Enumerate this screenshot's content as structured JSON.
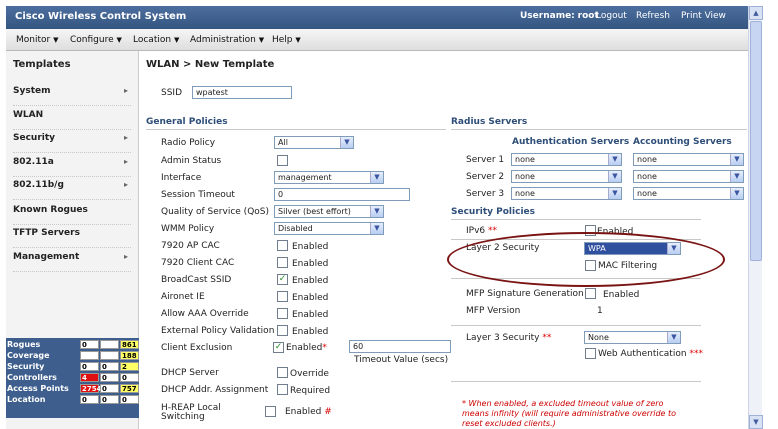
{
  "header": {
    "title": "Cisco Wireless Control System",
    "username_label": "Username:",
    "username": "root",
    "links": [
      "Logout",
      "Refresh",
      "Print View"
    ]
  },
  "menu": [
    "Monitor",
    "Configure",
    "Location",
    "Administration",
    "Help"
  ],
  "sidebar": {
    "title": "Templates",
    "items": [
      {
        "label": "System",
        "chevron": true
      },
      {
        "label": "WLAN",
        "chevron": false
      },
      {
        "label": "Security",
        "chevron": true
      },
      {
        "label": "802.11a",
        "chevron": true
      },
      {
        "label": "802.11b/g",
        "chevron": true
      },
      {
        "label": "Known Rogues",
        "chevron": false
      },
      {
        "label": "TFTP Servers",
        "chevron": false
      },
      {
        "label": "Management",
        "chevron": true
      }
    ]
  },
  "status": [
    {
      "label": "Rogues",
      "v1": "0",
      "v2": "",
      "v3": "861"
    },
    {
      "label": "Coverage",
      "v1": "",
      "v2": "",
      "v3": "188"
    },
    {
      "label": "Security",
      "v1": "0",
      "v2": "0",
      "v3": "2"
    },
    {
      "label": "Controllers",
      "v1": "4",
      "v2": "0",
      "v3": "0"
    },
    {
      "label": "Access Points",
      "v1": "2754",
      "v2": "0",
      "v3": "757"
    },
    {
      "label": "Location",
      "v1": "0",
      "v2": "0",
      "v3": "0"
    }
  ],
  "main": {
    "breadcrumb": "WLAN > New Template",
    "ssid_label": "SSID",
    "ssid_value": "wpatest",
    "general_title": "General Policies",
    "general": {
      "radio_policy_label": "Radio Policy",
      "radio_policy": "All",
      "admin_status_label": "Admin Status",
      "interface_label": "Interface",
      "interface": "management",
      "session_timeout_label": "Session Timeout",
      "session_timeout": "0",
      "qos_label": "Quality of Service (QoS)",
      "qos": "Silver (best effort)",
      "wmm_label": "WMM Policy",
      "wmm": "Disabled",
      "cac7920_label": "7920 AP CAC",
      "cac7920_text": "Enabled",
      "client_cac_label": "7920 Client CAC",
      "client_cac_text": "Enabled",
      "broadcast_label": "BroadCast SSID",
      "broadcast_text": "Enabled",
      "aironet_label": "Aironet IE",
      "aironet_text": "Enabled",
      "aaa_label": "Allow AAA Override",
      "aaa_text": "Enabled",
      "epv_label": "External Policy Validation",
      "epv_text": "Enabled",
      "client_excl_label": "Client Exclusion",
      "client_excl_text": "Enabled",
      "client_excl_req": "*",
      "timeout_value": "60",
      "timeout_label": "Timeout Value (secs)",
      "dhcp_server_label": "DHCP Server",
      "dhcp_server_text": "Override",
      "dhcp_addr_label": "DHCP Addr. Assignment",
      "dhcp_addr_text": "Required",
      "hreap_label_1": "H-REAP Local",
      "hreap_label_2": "Switching",
      "hreap_text": "Enabled",
      "hreap_req": "#"
    },
    "radius_title": "Radius Servers",
    "auth_head": "Authentication Servers",
    "acct_head": "Accounting Servers",
    "servers": [
      {
        "label": "Server 1",
        "auth": "none",
        "acct": "none"
      },
      {
        "label": "Server 2",
        "auth": "none",
        "acct": "none"
      },
      {
        "label": "Server 3",
        "auth": "none",
        "acct": "none"
      }
    ],
    "security_title": "Security Policies",
    "ipv6_label": "IPv6",
    "ipv6_req": "**",
    "ipv6_text": "Enabled",
    "l2_label": "Layer 2 Security",
    "l2_value": "WPA",
    "mac_filter_text": "MAC Filtering",
    "mfp_label": "MFP Signature Generation",
    "mfp_text": "Enabled",
    "mfp_version_label": "MFP Version",
    "mfp_version": "1",
    "l3_label": "Layer 3 Security",
    "l3_req": "**",
    "l3_value": "None",
    "web_auth_text": "Web Authentication",
    "web_auth_req": "***",
    "note_lines": [
      "* When enabled, a excluded timeout value of zero",
      "means infinity (will require administrative override to",
      "reset excluded clients.)"
    ]
  }
}
